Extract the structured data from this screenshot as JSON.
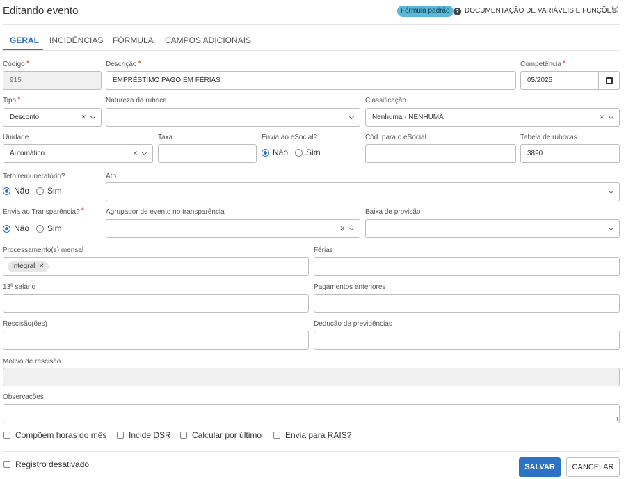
{
  "header": {
    "title": "Editando evento",
    "badge": "Fórmula padrão",
    "doc_link": "DOCUMENTAÇÃO DE VARIÁVEIS E FUNÇÕES"
  },
  "tabs": [
    {
      "label": "GERAL",
      "active": true
    },
    {
      "label": "INCIDÊNCIAS",
      "active": false
    },
    {
      "label": "FÓRMULA",
      "active": false
    },
    {
      "label": "CAMPOS ADICIONAIS",
      "active": false
    }
  ],
  "form": {
    "codigo": {
      "label": "Código",
      "value": "915"
    },
    "descricao": {
      "label": "Descrição",
      "value": "EMPRÉSTIMO PAGO EM FÉRIAS"
    },
    "competencia": {
      "label": "Competência",
      "value": "05/2025"
    },
    "tipo": {
      "label": "Tipo",
      "value": "Desconto"
    },
    "natureza": {
      "label": "Natureza da rubrica",
      "value": ""
    },
    "classificacao": {
      "label": "Classificação",
      "value": "Nenhuma - NENHUMA"
    },
    "unidade": {
      "label": "Unidade",
      "value": "Automático"
    },
    "taxa": {
      "label": "Taxa",
      "value": ""
    },
    "envia_esocial": {
      "label": "Envia ao eSocial?",
      "options": [
        "Não",
        "Sim"
      ],
      "selected": "Não"
    },
    "cod_esocial": {
      "label": "Cód. para o eSocial",
      "value": ""
    },
    "tabela_rubricas": {
      "label": "Tabela de rubricas",
      "value": "3890"
    },
    "teto": {
      "label": "Teto remuneratório?",
      "options": [
        "Não",
        "Sim"
      ],
      "selected": "Não"
    },
    "ato": {
      "label": "Ato",
      "value": ""
    },
    "envia_transparencia": {
      "label": "Envia ao Transparência?",
      "options": [
        "Não",
        "Sim"
      ],
      "selected": "Não"
    },
    "agrupador": {
      "label": "Agrupador de evento no transparência",
      "value": ""
    },
    "baixa_provisao": {
      "label": "Baixa de provisão",
      "value": ""
    },
    "processamento": {
      "label": "Processamento(s) mensal",
      "chips": [
        "Integral"
      ]
    },
    "ferias": {
      "label": "Férias",
      "value": ""
    },
    "decimo_terceiro": {
      "label": "13º salário",
      "value": ""
    },
    "pagamentos_anteriores": {
      "label": "Pagamentos anteriores",
      "value": ""
    },
    "rescisao": {
      "label": "Rescisão(ões)",
      "value": ""
    },
    "deducao": {
      "label": "Dedução de previdências",
      "value": ""
    },
    "motivo_rescisao": {
      "label": "Motivo de rescisão",
      "value": ""
    },
    "observacoes": {
      "label": "Observações",
      "value": ""
    }
  },
  "checkboxes": {
    "horas_mes": {
      "label": "Compõem horas do mês",
      "checked": false
    },
    "incide_dsr_prefix": "Incide ",
    "incide_dsr_abbr": "DSR",
    "incide_dsr": {
      "checked": false
    },
    "calcular_ultimo": {
      "label": "Calcular por último",
      "checked": false
    },
    "rais_prefix": "Envia para ",
    "rais_abbr": "RAIS?",
    "rais": {
      "checked": false
    },
    "registro_desativado": {
      "label": "Registro desativado",
      "checked": false
    }
  },
  "footer": {
    "save_label": "SALVAR",
    "cancel_label": "CANCELAR"
  },
  "colors": {
    "accent": "#2d73c4",
    "badge": "#5bb8d8",
    "required": "#d9342b"
  }
}
